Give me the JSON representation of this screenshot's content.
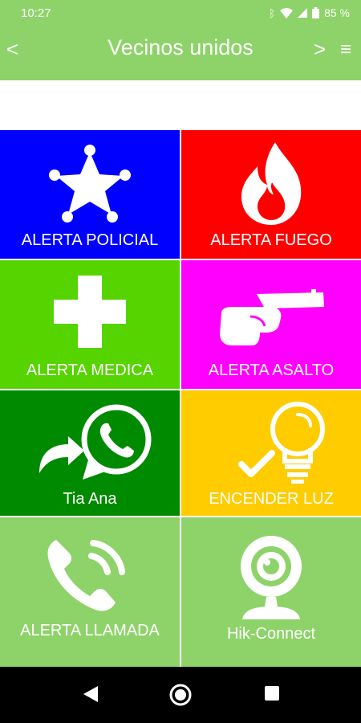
{
  "status_bar": {
    "time": "10:27",
    "battery_text": "85 %"
  },
  "app_bar": {
    "back_label": "<",
    "title": "Vecinos unidos",
    "forward_label": ">",
    "menu_label": "≡"
  },
  "tiles": [
    {
      "label": "ALERTA POLICIAL",
      "color": "#0000ff",
      "icon": "police-star-icon"
    },
    {
      "label": "ALERTA FUEGO",
      "color": "#ff0000",
      "icon": "flame-icon"
    },
    {
      "label": "ALERTA MEDICA",
      "color": "#55d400",
      "icon": "medical-cross-icon"
    },
    {
      "label": "ALERTA ASALTO",
      "color": "#ff00ff",
      "icon": "gun-icon"
    },
    {
      "label": "Tia Ana",
      "color": "#008a00",
      "icon": "whatsapp-share-icon"
    },
    {
      "label": "ENCENDER LUZ",
      "color": "#ffcc00",
      "icon": "light-bulb-check-icon"
    },
    {
      "label": "ALERTA LLAMADA",
      "color": "#8ed36a",
      "icon": "phone-call-icon"
    },
    {
      "label": "Hik-Connect",
      "color": "#8ed36a",
      "icon": "webcam-icon"
    }
  ]
}
